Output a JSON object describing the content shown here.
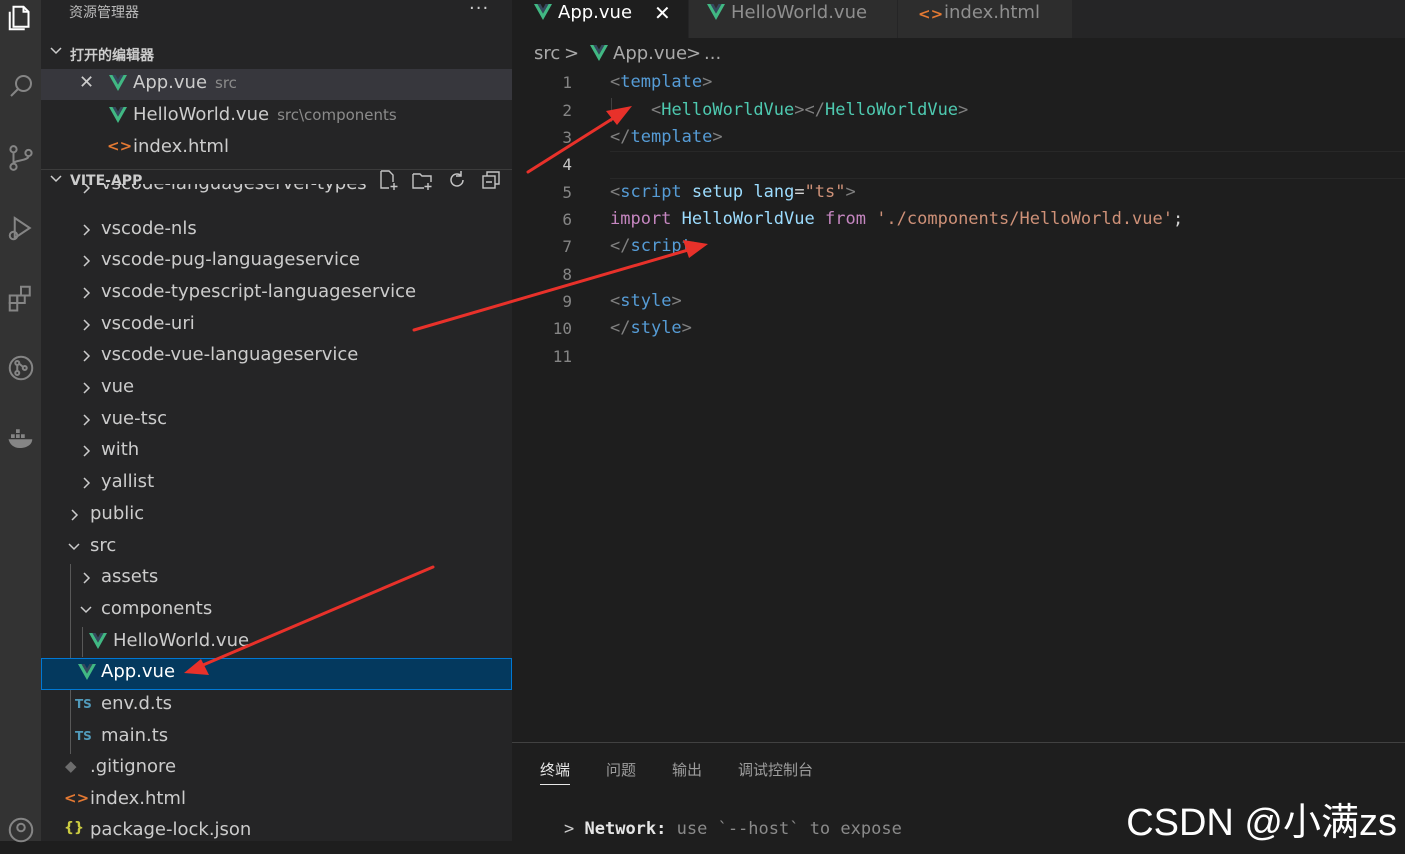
{
  "activity_bar": {
    "icons": [
      "files-icon",
      "search-icon",
      "source-control-icon",
      "run-debug-icon",
      "extensions-icon",
      "git-graph-icon",
      "docker-icon",
      "account-icon"
    ]
  },
  "sidebar": {
    "title": "资源管理器",
    "more": "···",
    "open_editors": {
      "header": "打开的编辑器",
      "items": [
        {
          "name": "App.vue",
          "hint": "src"
        },
        {
          "name": "HelloWorld.vue",
          "hint": "src\\components"
        },
        {
          "name": "index.html",
          "hint": ""
        }
      ]
    },
    "project": {
      "header": "VITE-APP",
      "tree": [
        {
          "label": "vscode-languageserver-types"
        },
        {
          "label": "vscode-nls"
        },
        {
          "label": "vscode-pug-languageservice"
        },
        {
          "label": "vscode-typescript-languageservice"
        },
        {
          "label": "vscode-uri"
        },
        {
          "label": "vscode-vue-languageservice"
        },
        {
          "label": "vue"
        },
        {
          "label": "vue-tsc"
        },
        {
          "label": "with"
        },
        {
          "label": "yallist"
        },
        {
          "label": "public"
        },
        {
          "label": "src"
        },
        {
          "label": "assets"
        },
        {
          "label": "components"
        },
        {
          "label": "HelloWorld.vue"
        },
        {
          "label": "App.vue"
        },
        {
          "label": "env.d.ts"
        },
        {
          "label": "main.ts"
        },
        {
          "label": ".gitignore"
        },
        {
          "label": "index.html"
        },
        {
          "label": "package-lock.json"
        }
      ]
    },
    "file_icons": {
      "ts": "TS",
      "html": "<>",
      "json": "{}",
      "git": "◆"
    }
  },
  "tabs": [
    {
      "label": "App.vue",
      "close": "✕"
    },
    {
      "label": "HelloWorld.vue"
    },
    {
      "label": "index.html"
    }
  ],
  "breadcrumb": {
    "folder": "src",
    "sep": ">",
    "file": "App.vue",
    "more": "..."
  },
  "editor": {
    "line_numbers": [
      "1",
      "2",
      "3",
      "4",
      "5",
      "6",
      "7",
      "8",
      "9",
      "10",
      "11"
    ],
    "code": {
      "l1_open": "<",
      "l1_tag": "template",
      "l1_close": ">",
      "l2_indent": "    ",
      "l2_open": "<",
      "l2_comp": "HelloWorldVue",
      "l2_mid": "></",
      "l2_comp2": "HelloWorldVue",
      "l2_close": ">",
      "l3_open": "</",
      "l3_tag": "template",
      "l3_close": ">",
      "l5_open": "<",
      "l5_tag": "script",
      "l5_sp1": " ",
      "l5_attr1": "setup",
      "l5_sp2": " ",
      "l5_attr2": "lang",
      "l5_eq": "=",
      "l5_val": "\"ts\"",
      "l5_close": ">",
      "l6_kw": "import",
      "l6_sp1": " ",
      "l6_id": "HelloWorldVue",
      "l6_sp2": " ",
      "l6_from": "from",
      "l6_sp3": " ",
      "l6_str": "'./components/HelloWorld.vue'",
      "l6_semi": ";",
      "l7_open": "</",
      "l7_tag": "script",
      "l7_close": ">",
      "l9_open": "<",
      "l9_tag": "style",
      "l9_close": ">",
      "l10_open": "</",
      "l10_tag": "style",
      "l10_close": ">"
    }
  },
  "panel": {
    "tabs": [
      "终端",
      "问题",
      "输出",
      "调试控制台"
    ],
    "terminal": {
      "prompt": ">",
      "label": "Network:",
      "text": "use `--host` to expose"
    },
    "watermark": "CSDN @小满zs"
  },
  "colors": {
    "accent": "#0078d4",
    "vue_green": "#41b883",
    "annotation_red": "#e8312a"
  }
}
